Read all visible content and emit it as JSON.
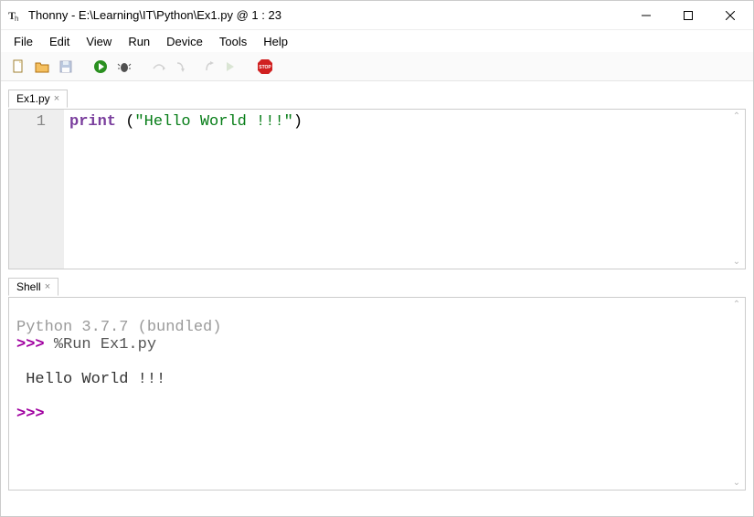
{
  "window": {
    "title": "Thonny  -  E:\\Learning\\IT\\Python\\Ex1.py  @  1 : 23",
    "minimize_glyph": "—",
    "app_icon": "thonny-icon"
  },
  "menus": [
    "File",
    "Edit",
    "View",
    "Run",
    "Device",
    "Tools",
    "Help"
  ],
  "toolbar_icons": [
    "new-file",
    "open-file",
    "save-file",
    "sep",
    "run-current",
    "debug",
    "sep",
    "step-over",
    "step-into",
    "step-out",
    "resume",
    "sep",
    "stop"
  ],
  "editor": {
    "tab_label": "Ex1.py",
    "line_number": "1",
    "code_kw": "print",
    "code_paren_open": " (",
    "code_str": "\"Hello World !!!\"",
    "code_paren_close": ")"
  },
  "shell": {
    "tab_label": "Shell",
    "version_line": "Python 3.7.7 (bundled)",
    "prompt": ">>> ",
    "run_cmd": "%Run Ex1.py",
    "output": " Hello World !!!",
    "blank": "",
    "prompt2": ">>> "
  }
}
